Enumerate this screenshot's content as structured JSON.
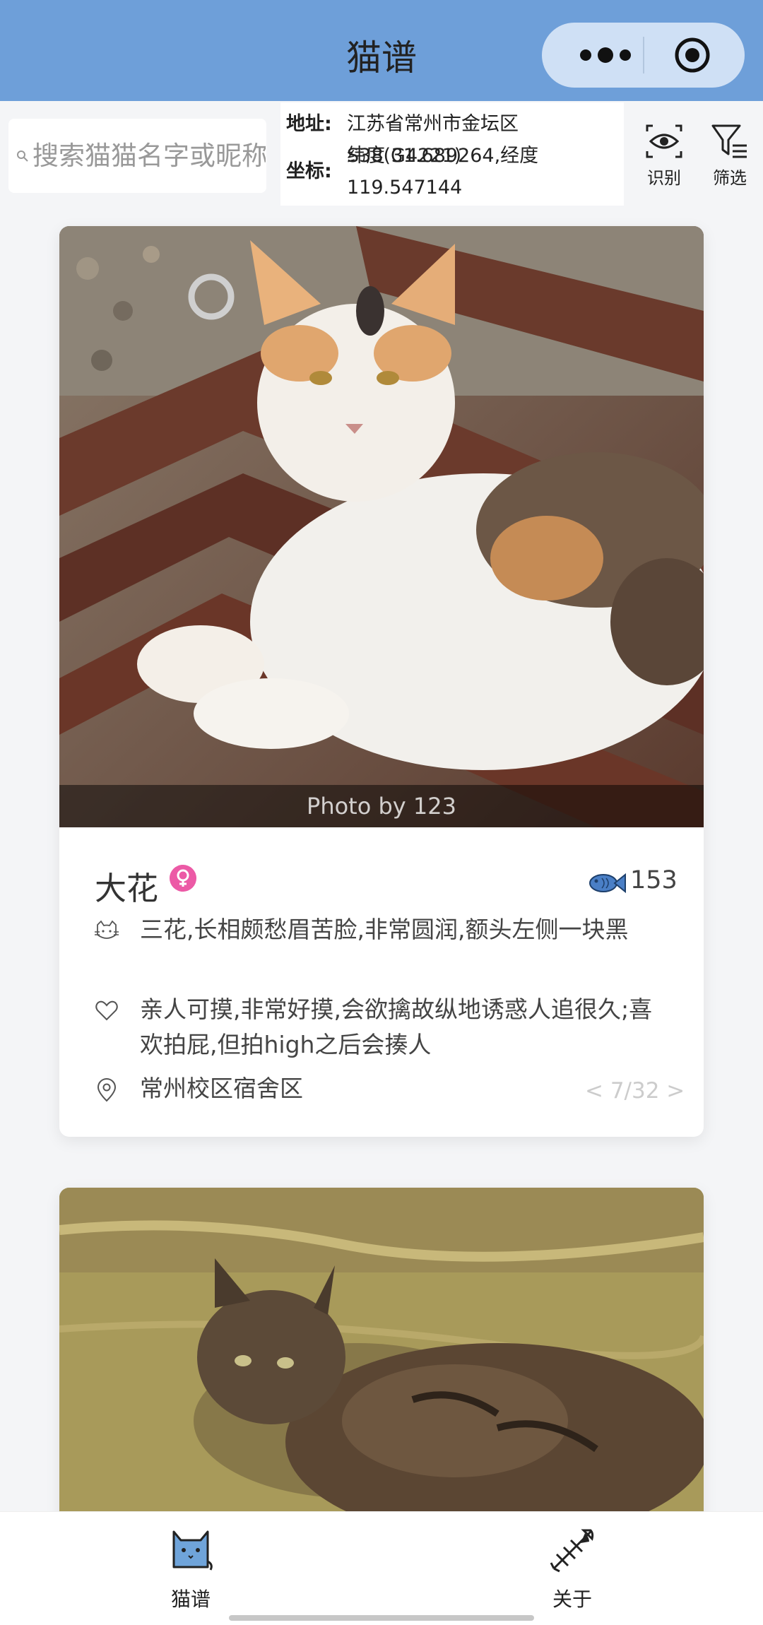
{
  "navbar": {
    "title": "猫谱",
    "color": "#6e9fd9",
    "menu_icon": "more-dots-icon",
    "close_icon": "target-icon"
  },
  "search": {
    "placeholder": "搜索猫猫名字或昵称"
  },
  "location": {
    "address_label": "地址:",
    "address": "江苏省常州市金坛区S38(G4221)",
    "coord_label": "坐标:",
    "coord": "纬度 31.689264,经度 119.547144"
  },
  "tools": [
    {
      "label": "识别",
      "icon": "eye-scan-icon"
    },
    {
      "label": "筛选",
      "icon": "filter-icon"
    }
  ],
  "cards": [
    {
      "photo_credit": "Photo by 123",
      "name": "大花",
      "gender": "female",
      "gender_icon": "female-icon",
      "fish_icon": "fish-icon",
      "fish_count": "153",
      "appearance": "三花,长相颇愁眉苦脸,非常圆润,额头左侧一块黑",
      "personality": "亲人可摸,非常好摸,会欲擒故纵地诱惑人追很久;喜欢拍屁,但拍high之后会揍人",
      "area": "常州校区宿舍区",
      "pager": "< 7/32 >"
    },
    {
      "name": "",
      "photo_credit": ""
    }
  ],
  "tabbar": {
    "tabs": [
      {
        "label": "猫谱",
        "icon": "cat-tab-icon",
        "active": true
      },
      {
        "label": "关于",
        "icon": "fishbone-tab-icon",
        "active": false
      }
    ]
  },
  "colors": {
    "accent": "#6e9fd9",
    "female": "#ec5aa6",
    "fish": "#4a7fc6"
  }
}
